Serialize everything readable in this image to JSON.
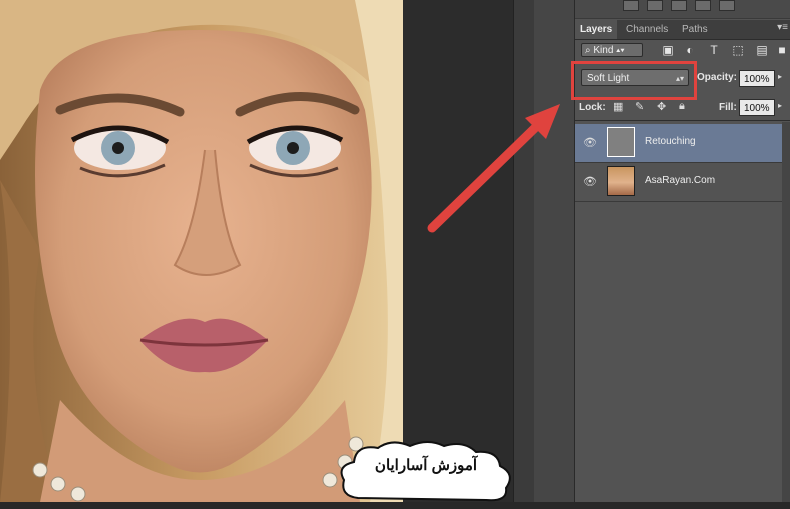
{
  "layers_panel": {
    "tabs": [
      {
        "label": "Layers",
        "active": true
      },
      {
        "label": "Channels",
        "active": false
      },
      {
        "label": "Paths",
        "active": false
      }
    ],
    "filter": {
      "kind_label": "Kind"
    },
    "blend_mode": "Soft Light",
    "opacity_label": "Opacity:",
    "opacity_value": "100%",
    "lock_label": "Lock:",
    "fill_label": "Fill:",
    "fill_value": "100%",
    "layers": [
      {
        "name": "Retouching",
        "visible": true,
        "selected": true
      },
      {
        "name": "AsaRayan.Com",
        "visible": true,
        "selected": false
      }
    ]
  },
  "annotation": {
    "highlight_color": "#e0433e",
    "cloud_text": "آموزش آسارایان"
  }
}
